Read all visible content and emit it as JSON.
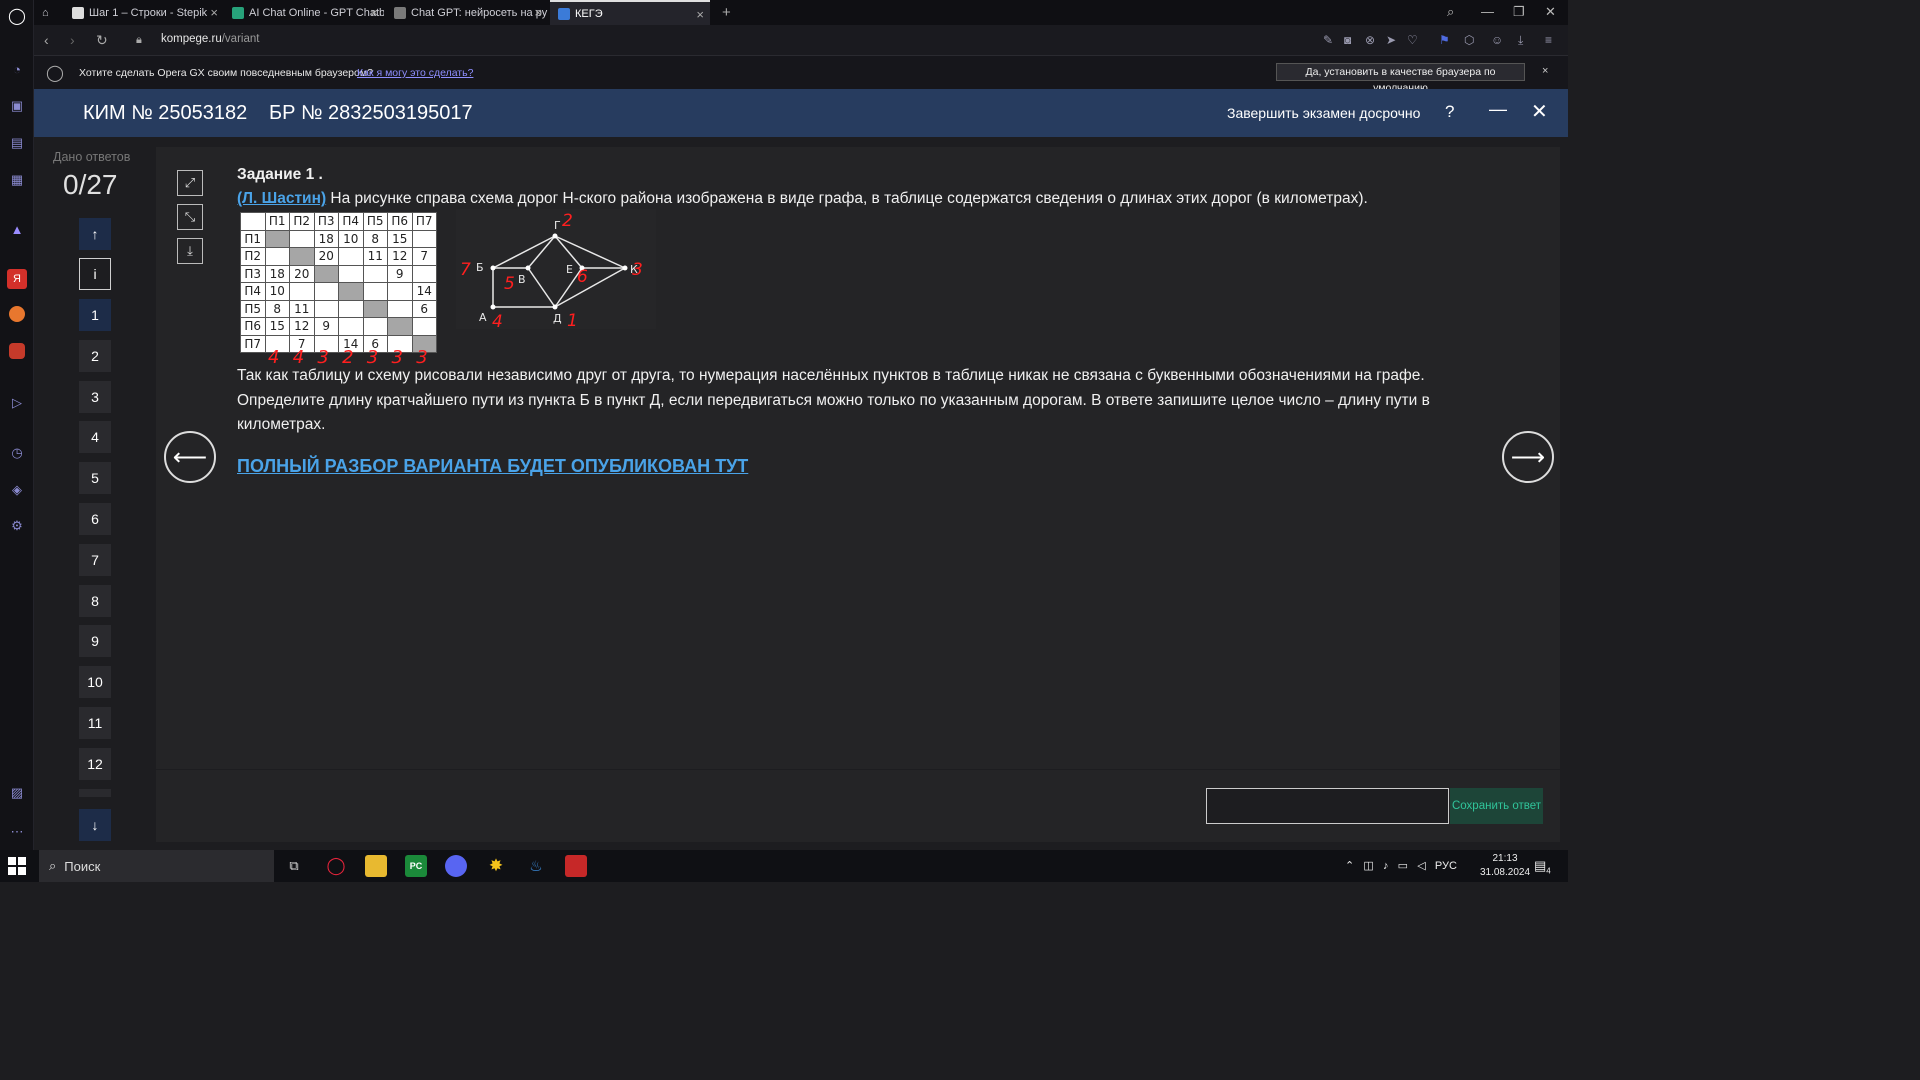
{
  "browser": {
    "tabs": [
      {
        "label": "Шаг 1 – Строки - Stepik"
      },
      {
        "label": "AI Chat Online - GPT Chatb"
      },
      {
        "label": "Chat GPT: нейросеть на ру"
      },
      {
        "label": "КЕГЭ"
      }
    ],
    "url_domain": "kompege.ru",
    "url_path": "/variant",
    "new_tab_symbol": "+",
    "notification": {
      "message": "Хотите сделать Opera GX своим повседневным браузером?",
      "link": "Как я могу это сделать?",
      "set_default_button": "Да, установить в качестве браузера по умолчанию",
      "close_symbol": "×"
    }
  },
  "exam": {
    "kim": "КИМ № 25053182",
    "br": "БР № 2832503195017",
    "finish_label": "Завершить экзамен досрочно",
    "help_symbol": "?",
    "minimize_symbol": "—",
    "close_symbol": "✕"
  },
  "answers_panel": {
    "given_label": "Дано ответов",
    "given_value": "0/27",
    "up_symbol": "↑",
    "info_symbol": "i",
    "down_symbol": "↓",
    "questions": [
      "1",
      "2",
      "3",
      "4",
      "5",
      "6",
      "7",
      "8",
      "9",
      "10",
      "11",
      "12"
    ]
  },
  "task": {
    "title": "Задание 1 .",
    "author": "(Л. Шастин)",
    "text1": " На рисунке справа схема дорог Н-ского района изображена в виде графа, в таблице содержатся сведения о длинах этих дорог (в километрах).",
    "text2": "Так как таблицу и схему рисовали независимо друг от друга, то нумерация населённых пунктов в таблице никак не связана с буквенными обозначениями на графе. Определите длину кратчайшего пути из пункта Б в пункт Д, если передвигаться можно только по указанным дорогам. В ответе запишите целое число – длину пути в километрах.",
    "publish_link": "ПОЛНЫЙ РАЗБОР ВАРИАНТА БУДЕТ ОПУБЛИКОВАН ТУТ",
    "prev_symbol": "⟵",
    "next_symbol": "⟶"
  },
  "distance_table": {
    "headers": [
      "",
      "П1",
      "П2",
      "П3",
      "П4",
      "П5",
      "П6",
      "П7"
    ],
    "rows": [
      [
        "П1",
        "",
        "",
        "18",
        "10",
        "8",
        "15",
        ""
      ],
      [
        "П2",
        "",
        "",
        "20",
        "",
        "11",
        "12",
        "7"
      ],
      [
        "П3",
        "18",
        "20",
        "",
        "",
        "",
        "9",
        ""
      ],
      [
        "П4",
        "10",
        "",
        "",
        "",
        "",
        "",
        "14"
      ],
      [
        "П5",
        "8",
        "11",
        "",
        "",
        "",
        "",
        "6"
      ],
      [
        "П6",
        "15",
        "12",
        "9",
        "",
        "",
        "",
        ""
      ],
      [
        "П7",
        "",
        "7",
        "",
        "14",
        "6",
        "",
        ""
      ]
    ],
    "handwritten_degrees": [
      "4",
      "4",
      "3",
      "2",
      "3",
      "3",
      "3"
    ]
  },
  "graph": {
    "nodes": [
      {
        "label": "Г",
        "annotation": "2"
      },
      {
        "label": "Б",
        "annotation": "7"
      },
      {
        "label": "В",
        "annotation": "5"
      },
      {
        "label": "Е",
        "annotation": "6"
      },
      {
        "label": "К",
        "annotation": "3"
      },
      {
        "label": "А",
        "annotation": "4"
      },
      {
        "label": "Д",
        "annotation": "1"
      }
    ],
    "annotation_color": "#ff1f1f"
  },
  "answer": {
    "placeholder": "",
    "save_label": "Сохранить ответ"
  },
  "taskbar": {
    "search_placeholder": "Поиск",
    "language": "РУС",
    "time": "21:13",
    "date": "31.08.2024",
    "notification_count": "4"
  },
  "colors": {
    "exam_header": "#273c5f",
    "link": "#4aa3e8",
    "save_text": "#30c49a"
  }
}
